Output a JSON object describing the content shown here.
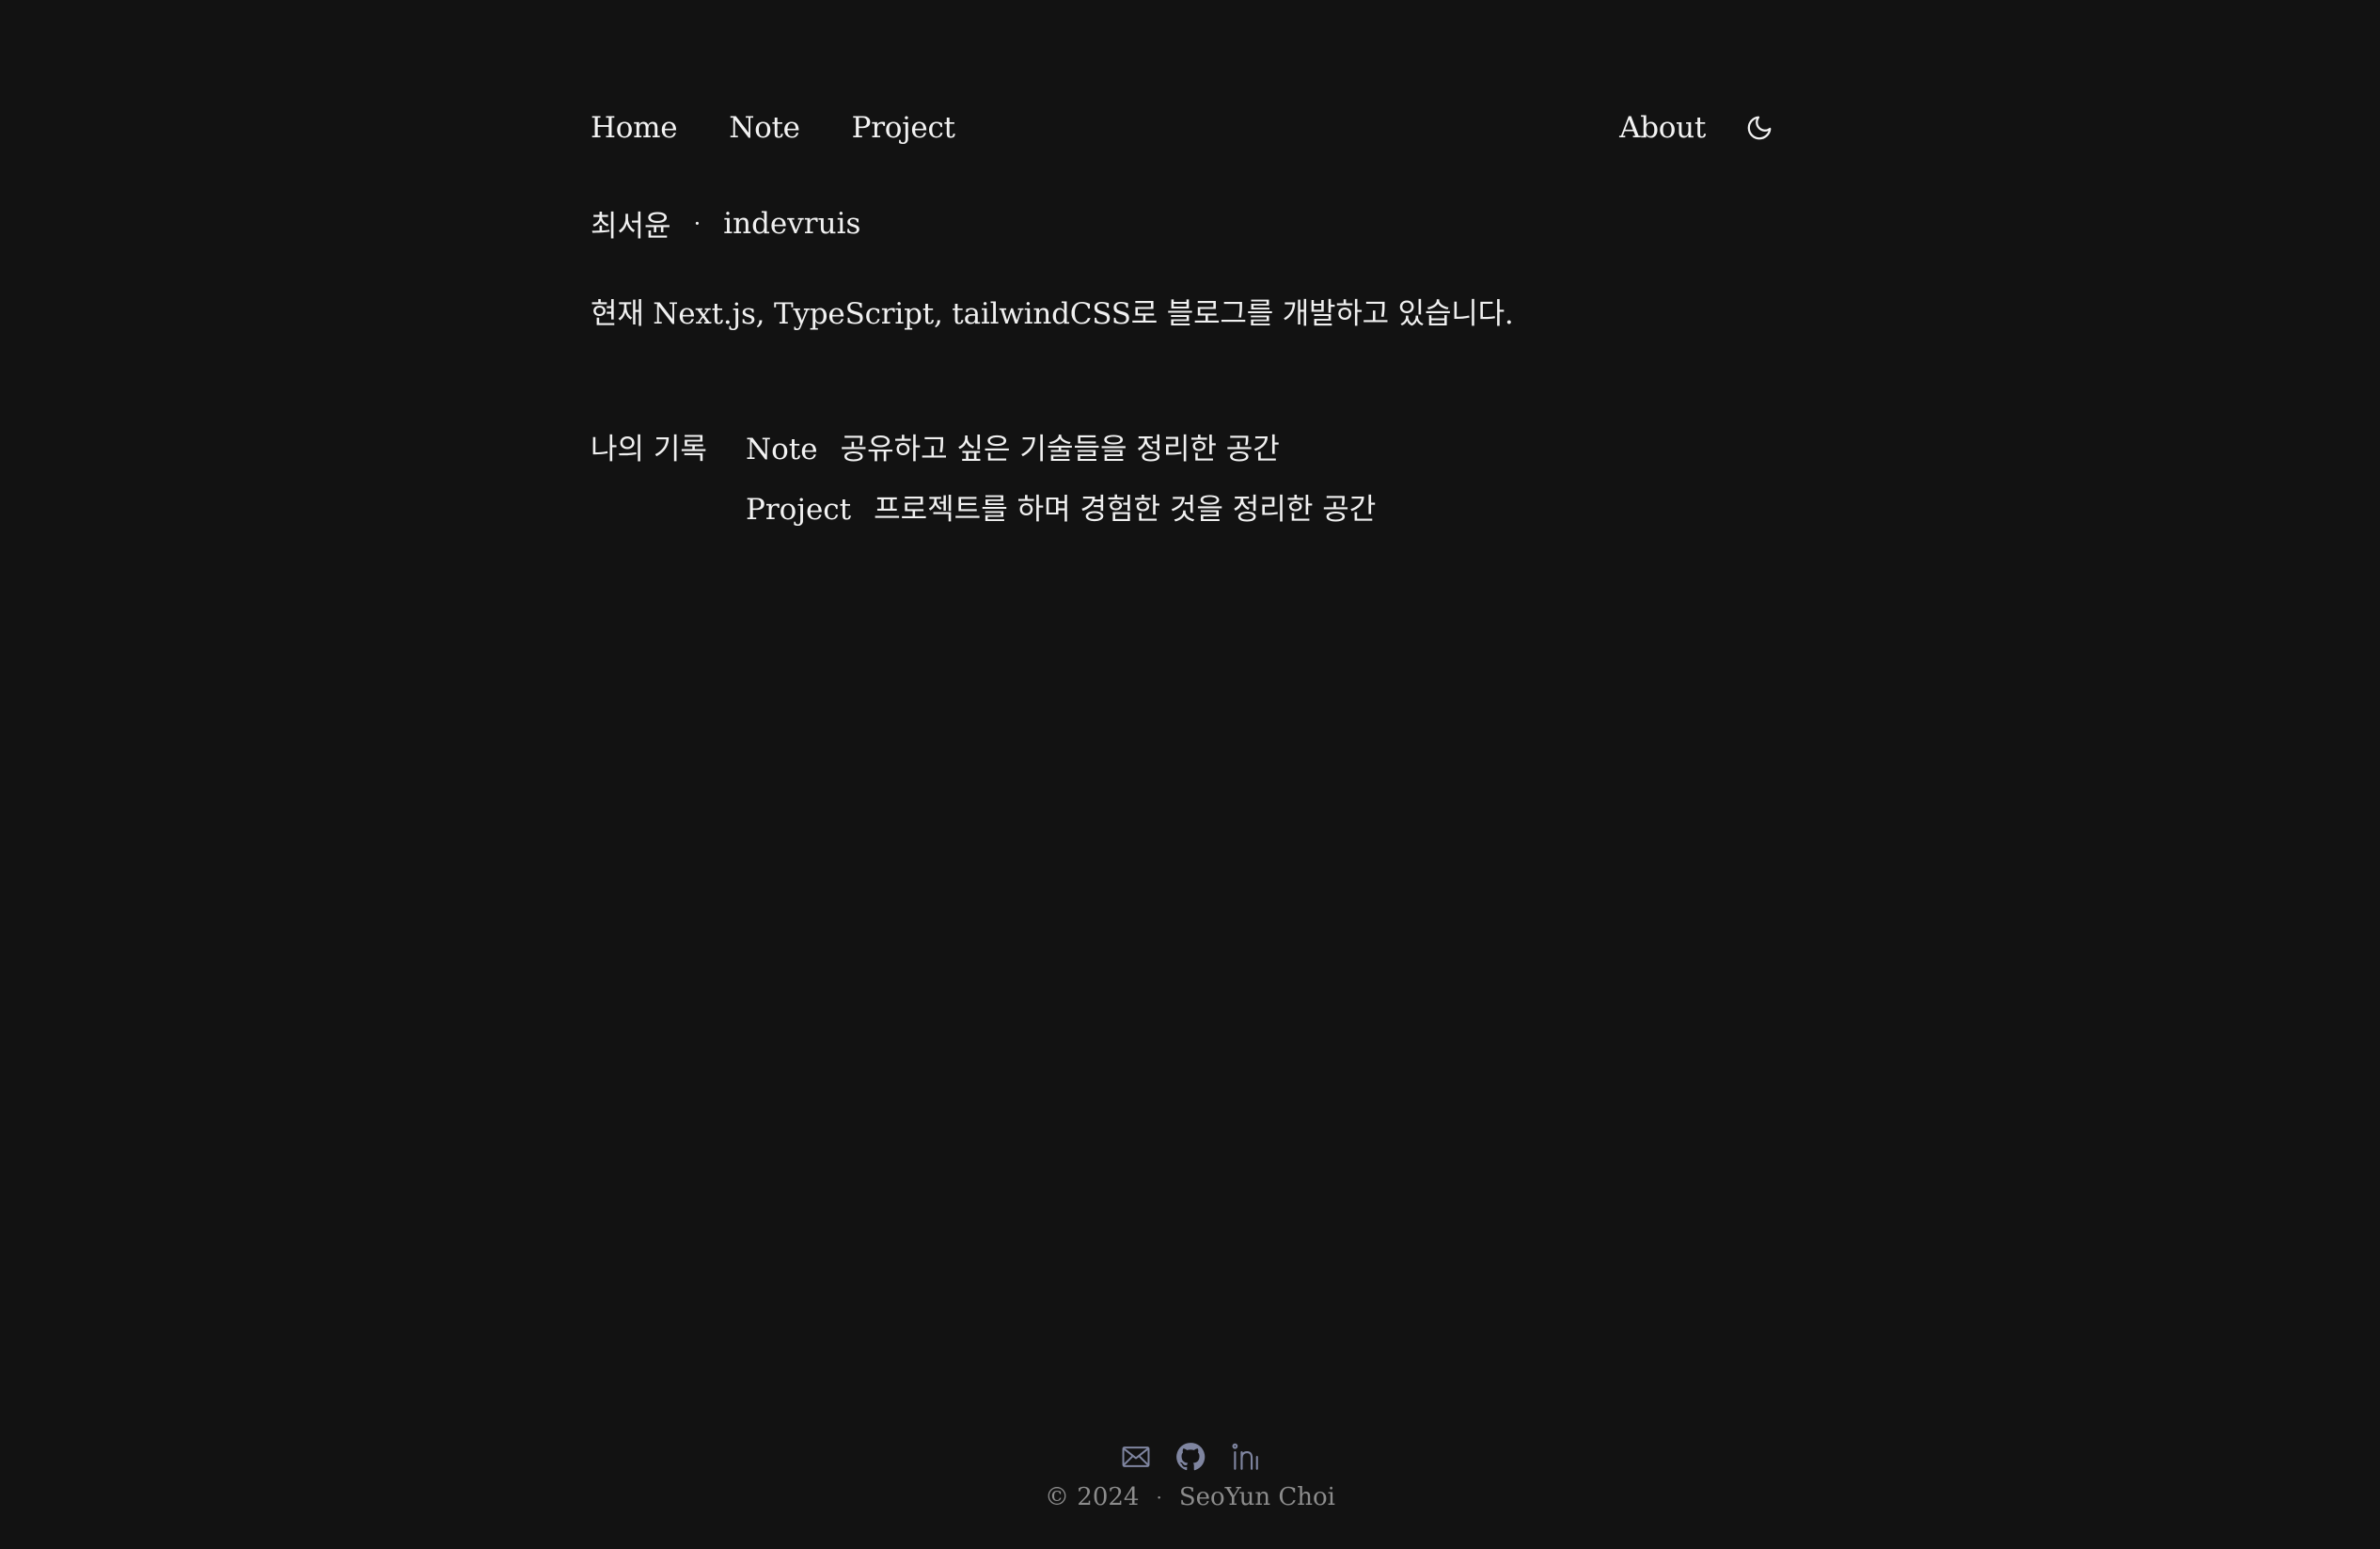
{
  "nav": {
    "home": "Home",
    "note": "Note",
    "project": "Project",
    "about": "About",
    "theme_icon": "moon-icon"
  },
  "intro": {
    "name": "최서윤",
    "separator": "·",
    "handle": "indevruis",
    "description": "현재 Next.js, TypeScript, tailwindCSS로 블로그를 개발하고 있습니다."
  },
  "records": {
    "label": "나의 기록",
    "items": [
      {
        "link": "Note",
        "description": "공유하고 싶은 기술들을 정리한 공간"
      },
      {
        "link": "Project",
        "description": "프로젝트를 하며 경험한 것을 정리한 공간"
      }
    ]
  },
  "footer": {
    "icons": [
      "mail-icon",
      "github-icon",
      "linkedin-icon"
    ],
    "year": "© 2024",
    "separator": "·",
    "author": "SeoYun Choi"
  },
  "colors": {
    "background": "#121212",
    "text": "#f0f0f0",
    "muted": "#8c8c8c",
    "footer_icon": "#7f85a0"
  }
}
